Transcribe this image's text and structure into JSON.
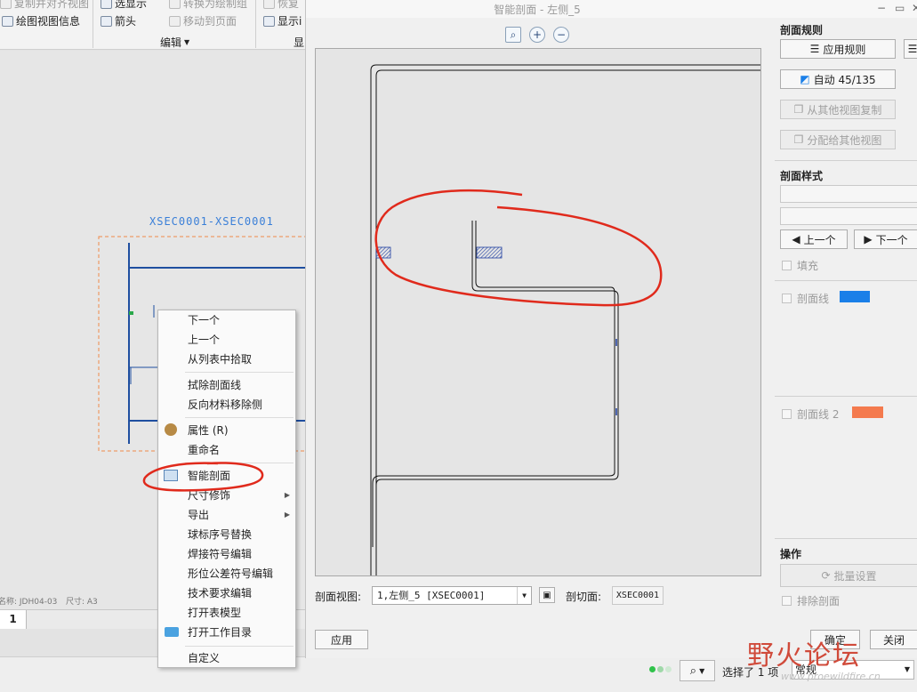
{
  "ribbon": {
    "items": {
      "copy_view": "复制并对齐视图",
      "view_info": "绘图视图信息",
      "show": "选显示",
      "arrow": "箭头",
      "convert": "转换为绘制组",
      "move_to_page": "移动到页面",
      "restore": "恢复",
      "display": "显示i"
    },
    "group_edit": "编辑",
    "group_display": "显"
  },
  "drawing": {
    "section_label": "XSEC0001-XSEC0001",
    "info_name": "名称: JDH04-03",
    "info_size": "尺寸: A3",
    "sheet_tab": "1"
  },
  "context_menu": {
    "items": [
      {
        "label": "下一个"
      },
      {
        "label": "上一个"
      },
      {
        "label": "从列表中拾取"
      },
      {
        "label": "拭除剖面线"
      },
      {
        "label": "反向材料移除侧"
      },
      {
        "label": "属性 (R)"
      },
      {
        "label": "重命名"
      },
      {
        "label": "智能剖面"
      },
      {
        "label": "尺寸修饰"
      },
      {
        "label": "导出"
      },
      {
        "label": "球标序号替换"
      },
      {
        "label": "焊接符号编辑"
      },
      {
        "label": "形位公差符号编辑"
      },
      {
        "label": "技术要求编辑"
      },
      {
        "label": "打开表模型"
      },
      {
        "label": "打开工作目录"
      },
      {
        "label": "自定义"
      }
    ]
  },
  "dialog": {
    "title": "智能剖面 - 左侧_5",
    "rules_header": "剖面规则",
    "apply_rules": "应用规则",
    "auto": "自动 45/135",
    "copy_from_other": "从其他视图复制",
    "assign_to_other": "分配给其他视图",
    "style_header": "剖面样式",
    "prev": "上一个",
    "next": "下一个",
    "fill": "填充",
    "hatch1": "剖面线",
    "hatch2": "剖面线 2",
    "hatch1_color": "#1a7fe8",
    "hatch2_color": "#f47a4e",
    "ops_header": "操作",
    "batch": "批量设置",
    "exclude": "排除剖面",
    "section_view_label": "剖面视图:",
    "section_view_value": "1,左侧_5 [XSEC0001]",
    "cut_plane_label": "剖切面:",
    "cut_plane_value": "XSEC0001",
    "apply": "应用",
    "ok": "确定",
    "close": "关闭"
  },
  "status": {
    "selected": "选择了 1 项",
    "filter": "常规"
  },
  "watermark": {
    "text": "野火论坛",
    "url": "www.proewildfire.cn"
  }
}
